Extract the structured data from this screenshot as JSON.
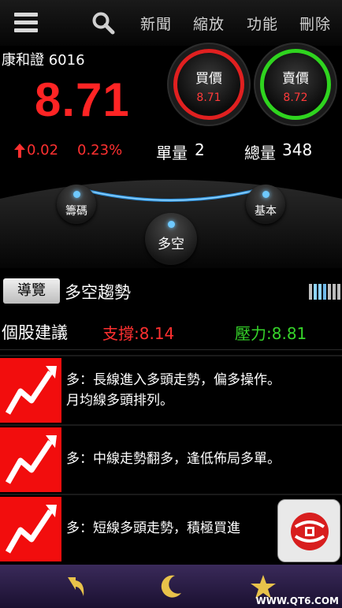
{
  "nav": {
    "news": "新聞",
    "zoom": "縮放",
    "function": "功能",
    "delete": "刪除"
  },
  "quote": {
    "name_code": "康和證 6016",
    "price": "8.71",
    "change": "0.02",
    "change_pct": "0.23%",
    "unit_volume_label": "單量",
    "unit_volume": "2",
    "total_volume_label": "總量",
    "total_volume": "348"
  },
  "buy": {
    "label": "買價",
    "value": "8.71"
  },
  "sell": {
    "label": "賣價",
    "value": "8.72"
  },
  "dial": {
    "chips": "籌碼",
    "fundamental": "基本",
    "long_short": "多空"
  },
  "section": {
    "guide_button": "導覽",
    "title": "多空趨勢"
  },
  "advice": {
    "title": "個股建議",
    "support": "支撐:8.14",
    "resistance": "壓力:8.81"
  },
  "trends": [
    {
      "line1": "多：長線進入多頭走勢，偏多操作。",
      "line2": "月均線多頭排列。"
    },
    {
      "line1": "多：中線走勢翻多，逢低佈局多單。",
      "line2": ""
    },
    {
      "line1": "多：短線多頭走勢，積極買進",
      "line2": ""
    }
  ],
  "watermark": "WWW.QT6.COM",
  "colors": {
    "up_red": "#ff3030",
    "down_green": "#36d42a",
    "buy_ring": "#e02020",
    "sell_ring": "#2fd41f",
    "trend_icon_bg": "#f20d0d",
    "bottom_bar": "#2a1d48"
  },
  "icons": [
    "menu-icon",
    "search-icon",
    "trend-up-icon",
    "back-icon",
    "moon-icon",
    "star-icon",
    "logo-icon"
  ]
}
